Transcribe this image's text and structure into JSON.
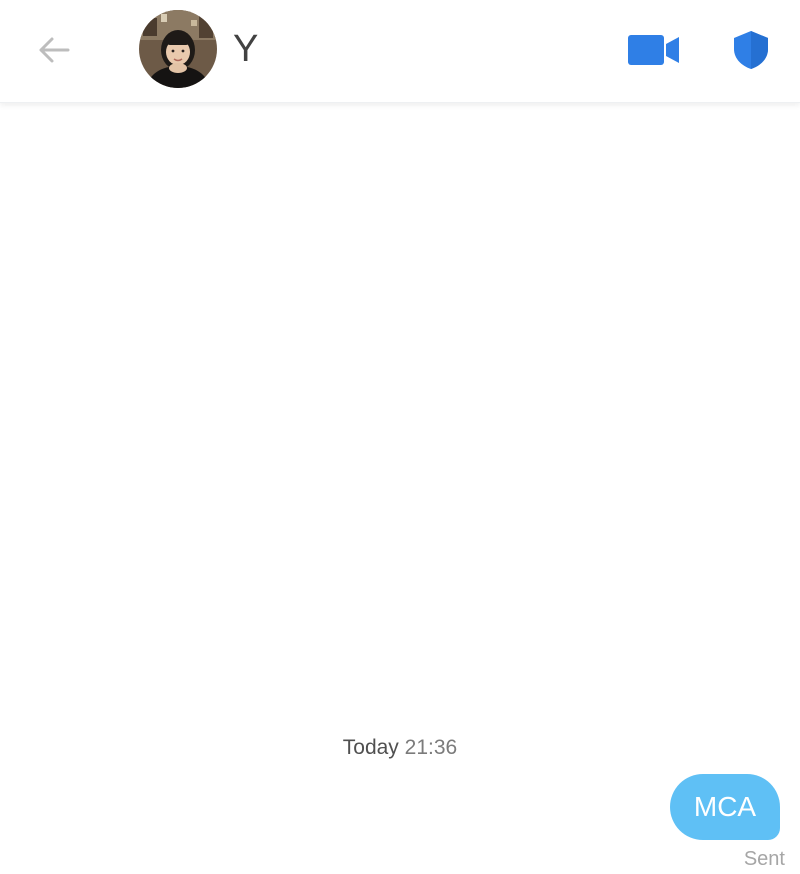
{
  "header": {
    "back_icon": "arrow-left-icon",
    "contact_name": "Y",
    "video_icon": "video-camera-icon",
    "safety_icon": "shield-icon",
    "accent_color": "#2f7fe6"
  },
  "conversation": {
    "timestamp_day": "Today",
    "timestamp_time": "21:36",
    "messages": [
      {
        "direction": "outgoing",
        "text": "MCA",
        "status": "Sent"
      }
    ],
    "bubble_color": "#5fc0f5"
  }
}
